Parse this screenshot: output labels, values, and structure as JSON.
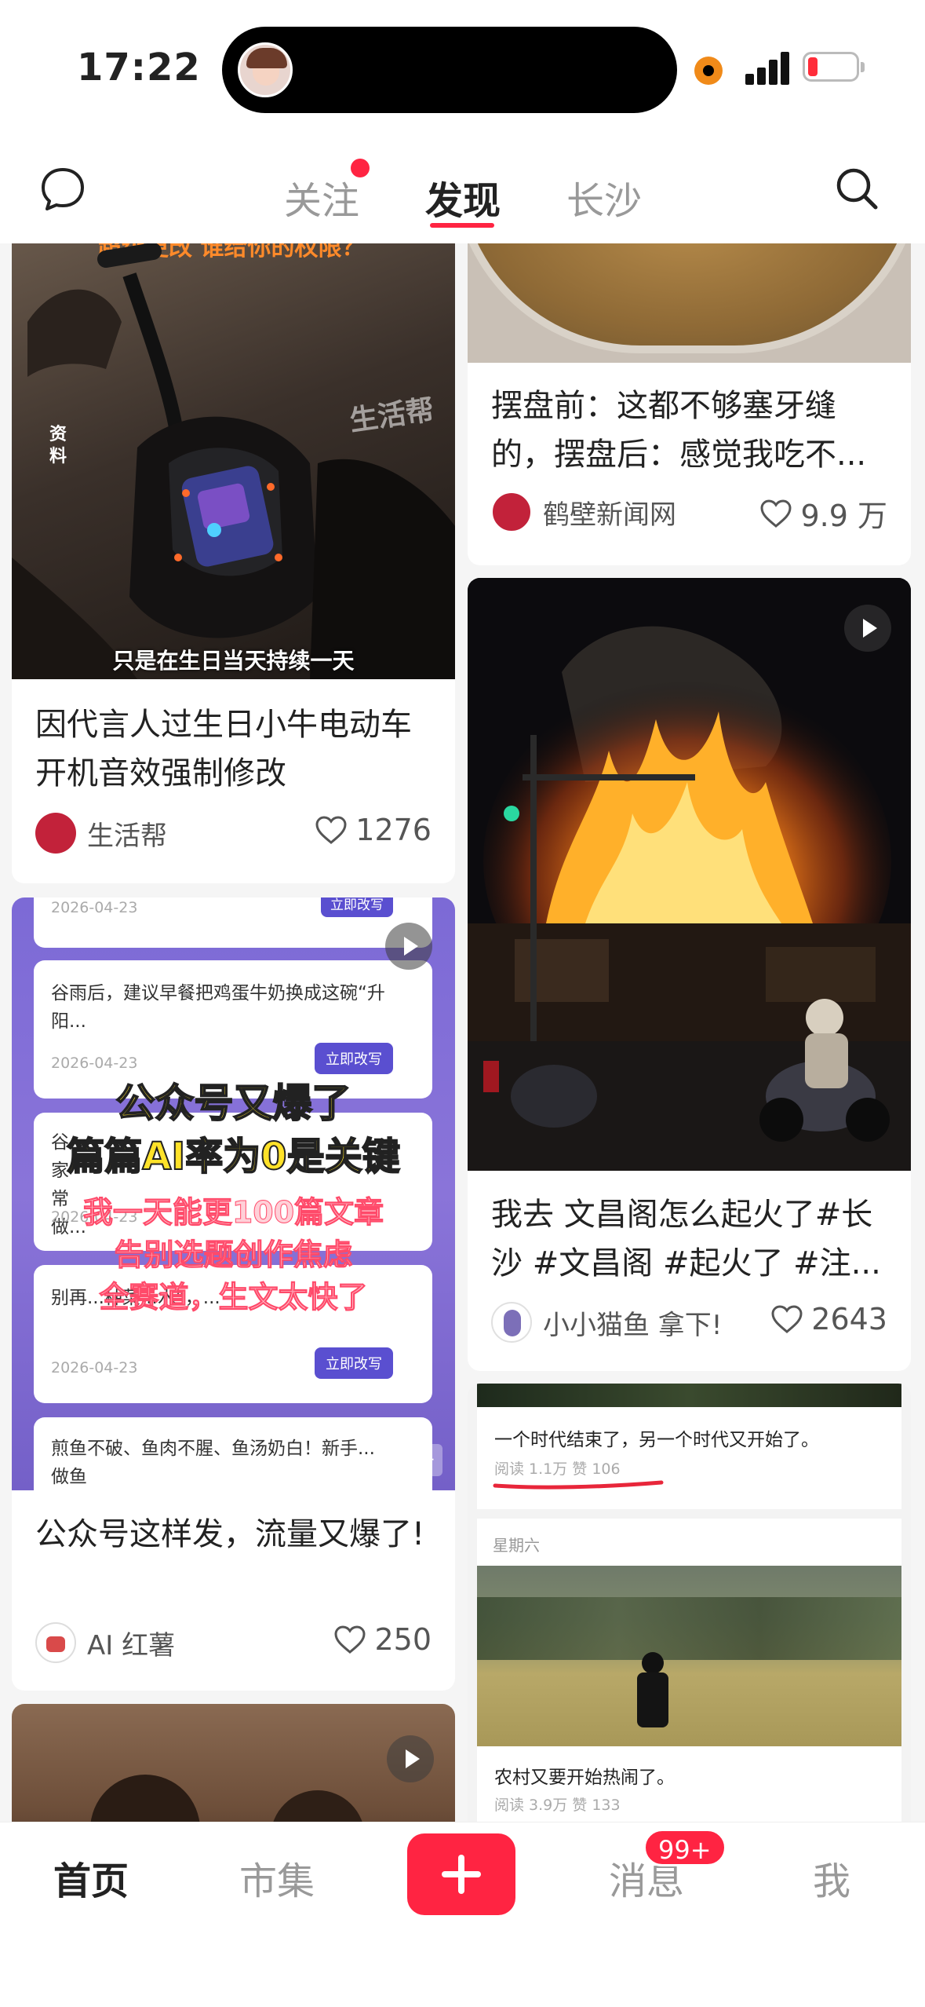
{
  "status_bar": {
    "time": "17:22"
  },
  "top_nav": {
    "tabs": [
      {
        "label": "关注"
      },
      {
        "label": "发现"
      },
      {
        "label": "长沙"
      }
    ]
  },
  "feed": {
    "left": [
      {
        "cover_caption_top": "超级更改 谁给你的权限？",
        "cover_watermark": "生活帮",
        "cover_side_tag": "资料",
        "cover_caption_bottom": "只是在生日当天持续一天",
        "title": "因代言人过生日小牛电动车开机音效强制修改",
        "author": "生活帮",
        "likes": "1276"
      },
      {
        "cover_list": [
          {
            "date": "2026-04-23",
            "button": "立即改写"
          },
          {
            "text": "谷雨后，建议早餐把鸡蛋牛奶换成这碗“升阳...",
            "date": "2026-04-23",
            "button": "立即改写"
          },
          {
            "text": "谷...家常做...",
            "date": "2026-04-23"
          },
          {
            "text": "别再...种菜...水”，...",
            "date": "2026-04-23",
            "button": "立即改写"
          },
          {
            "text": "煎鱼不破、鱼肉不腥、鱼汤奶白！新手...做鱼"
          }
        ],
        "cover_headline_1": "公众号又爆了",
        "cover_headline_2": "篇篇AI率为0是关键",
        "cover_sub_1": "我一天能更100篇文章",
        "cover_sub_2": "告别选题创作焦虑",
        "cover_sub_3": "全赛道，生文太快了",
        "ad_tag": "广告",
        "title": "公众号这样发，流量又爆了!",
        "author": "AI 红薯",
        "likes": "250"
      }
    ],
    "right": [
      {
        "title": "摆盘前：这都不够塞牙缝的，摆盘后：感觉我吃不...",
        "author": "鹤壁新闻网",
        "author_avatar_text": "鹤壁新闻网",
        "likes": "9.9 万"
      },
      {
        "title": "我去 文昌阁怎么起火了#长沙 #文昌阁 #起火了 #注...",
        "author": "小小猫鱼 拿下!",
        "likes": "2643"
      },
      {
        "cover_post_1": "一个时代结束了，另一个时代又开始了。",
        "cover_post_1_stats": "阅读 1.1万  赞 106",
        "cover_day": "星期六",
        "cover_post_2": "农村又要开始热闹了。",
        "cover_post_2_stats": "阅读 3.9万  赞 133"
      }
    ]
  },
  "bottom_nav": {
    "items": [
      {
        "label": "首页"
      },
      {
        "label": "市集"
      },
      {
        "label": "消息"
      },
      {
        "label": "我"
      }
    ],
    "msg_badge": "99+"
  },
  "colors": {
    "accent": "#ff2442",
    "text": "#222222",
    "muted": "#999999"
  }
}
